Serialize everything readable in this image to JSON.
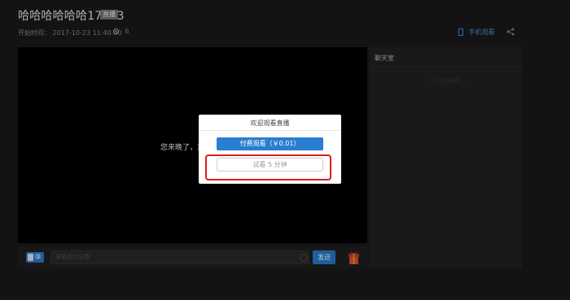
{
  "header": {
    "title": "哈哈哈哈哈哈17363",
    "status_badge": "直播",
    "start_label": "开始时间：",
    "start_time": "2017-10-23 11:40:00",
    "viewer_count": "6",
    "mobile_watch": "手机观看"
  },
  "player": {
    "overlay_text": "您来晚了，直"
  },
  "bottom_bar": {
    "danmaku_label": "弹",
    "chat_placeholder": "来说点什么吧",
    "send_label": "发送"
  },
  "chat": {
    "title": "聊天室",
    "ghost_text": "正在加载中..."
  },
  "modal": {
    "title": "欢迎观看直播",
    "paid_button": "付费观看（￥0.01）",
    "trial_button": "试看 5 分钟"
  },
  "colors": {
    "accent": "#2a7ed0",
    "highlight": "#d81e1e",
    "page_bg": "#1a1a1a"
  }
}
